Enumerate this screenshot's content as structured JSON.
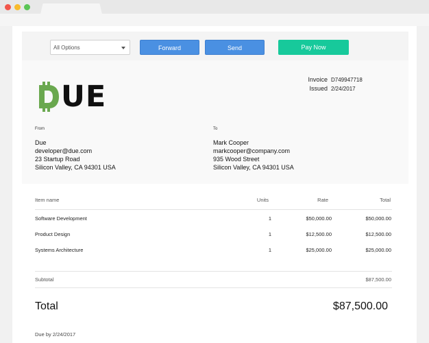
{
  "toolbar": {
    "select_value": "All Options",
    "forward_label": "Forward",
    "send_label": "Send",
    "pay_label": "Pay Now"
  },
  "logo": {
    "text": "DUE",
    "accent_color": "#6aa84f"
  },
  "invoice": {
    "invoice_label": "Invoice",
    "invoice_number": "D749947718",
    "issued_label": "Issued",
    "issued_date": "2/24/2017"
  },
  "from": {
    "label": "From",
    "name": "Due",
    "email": "developer@due.com",
    "street": "23 Startup Road",
    "city": "Silicon Valley, CA 94301 USA"
  },
  "to": {
    "label": "To",
    "name": "Mark Cooper",
    "email": "markcooper@company.com",
    "street": "935 Wood Street",
    "city": "Silicon Valley, CA 94301 USA"
  },
  "table": {
    "headers": [
      "Item name",
      "Units",
      "Rate",
      "Total"
    ],
    "rows": [
      {
        "item": "Software Development",
        "units": "1",
        "rate": "$50,000.00",
        "total": "$50,000.00"
      },
      {
        "item": "Product Design",
        "units": "1",
        "rate": "$12,500.00",
        "total": "$12,500.00"
      },
      {
        "item": "Systems Architecture",
        "units": "1",
        "rate": "$25,000.00",
        "total": "$25,000.00"
      }
    ]
  },
  "summary": {
    "subtotal_label": "Subtotal",
    "subtotal_value": "$87,500.00",
    "total_label": "Total",
    "total_value": "$87,500.00",
    "due_text": "Due by 2/24/2017"
  }
}
